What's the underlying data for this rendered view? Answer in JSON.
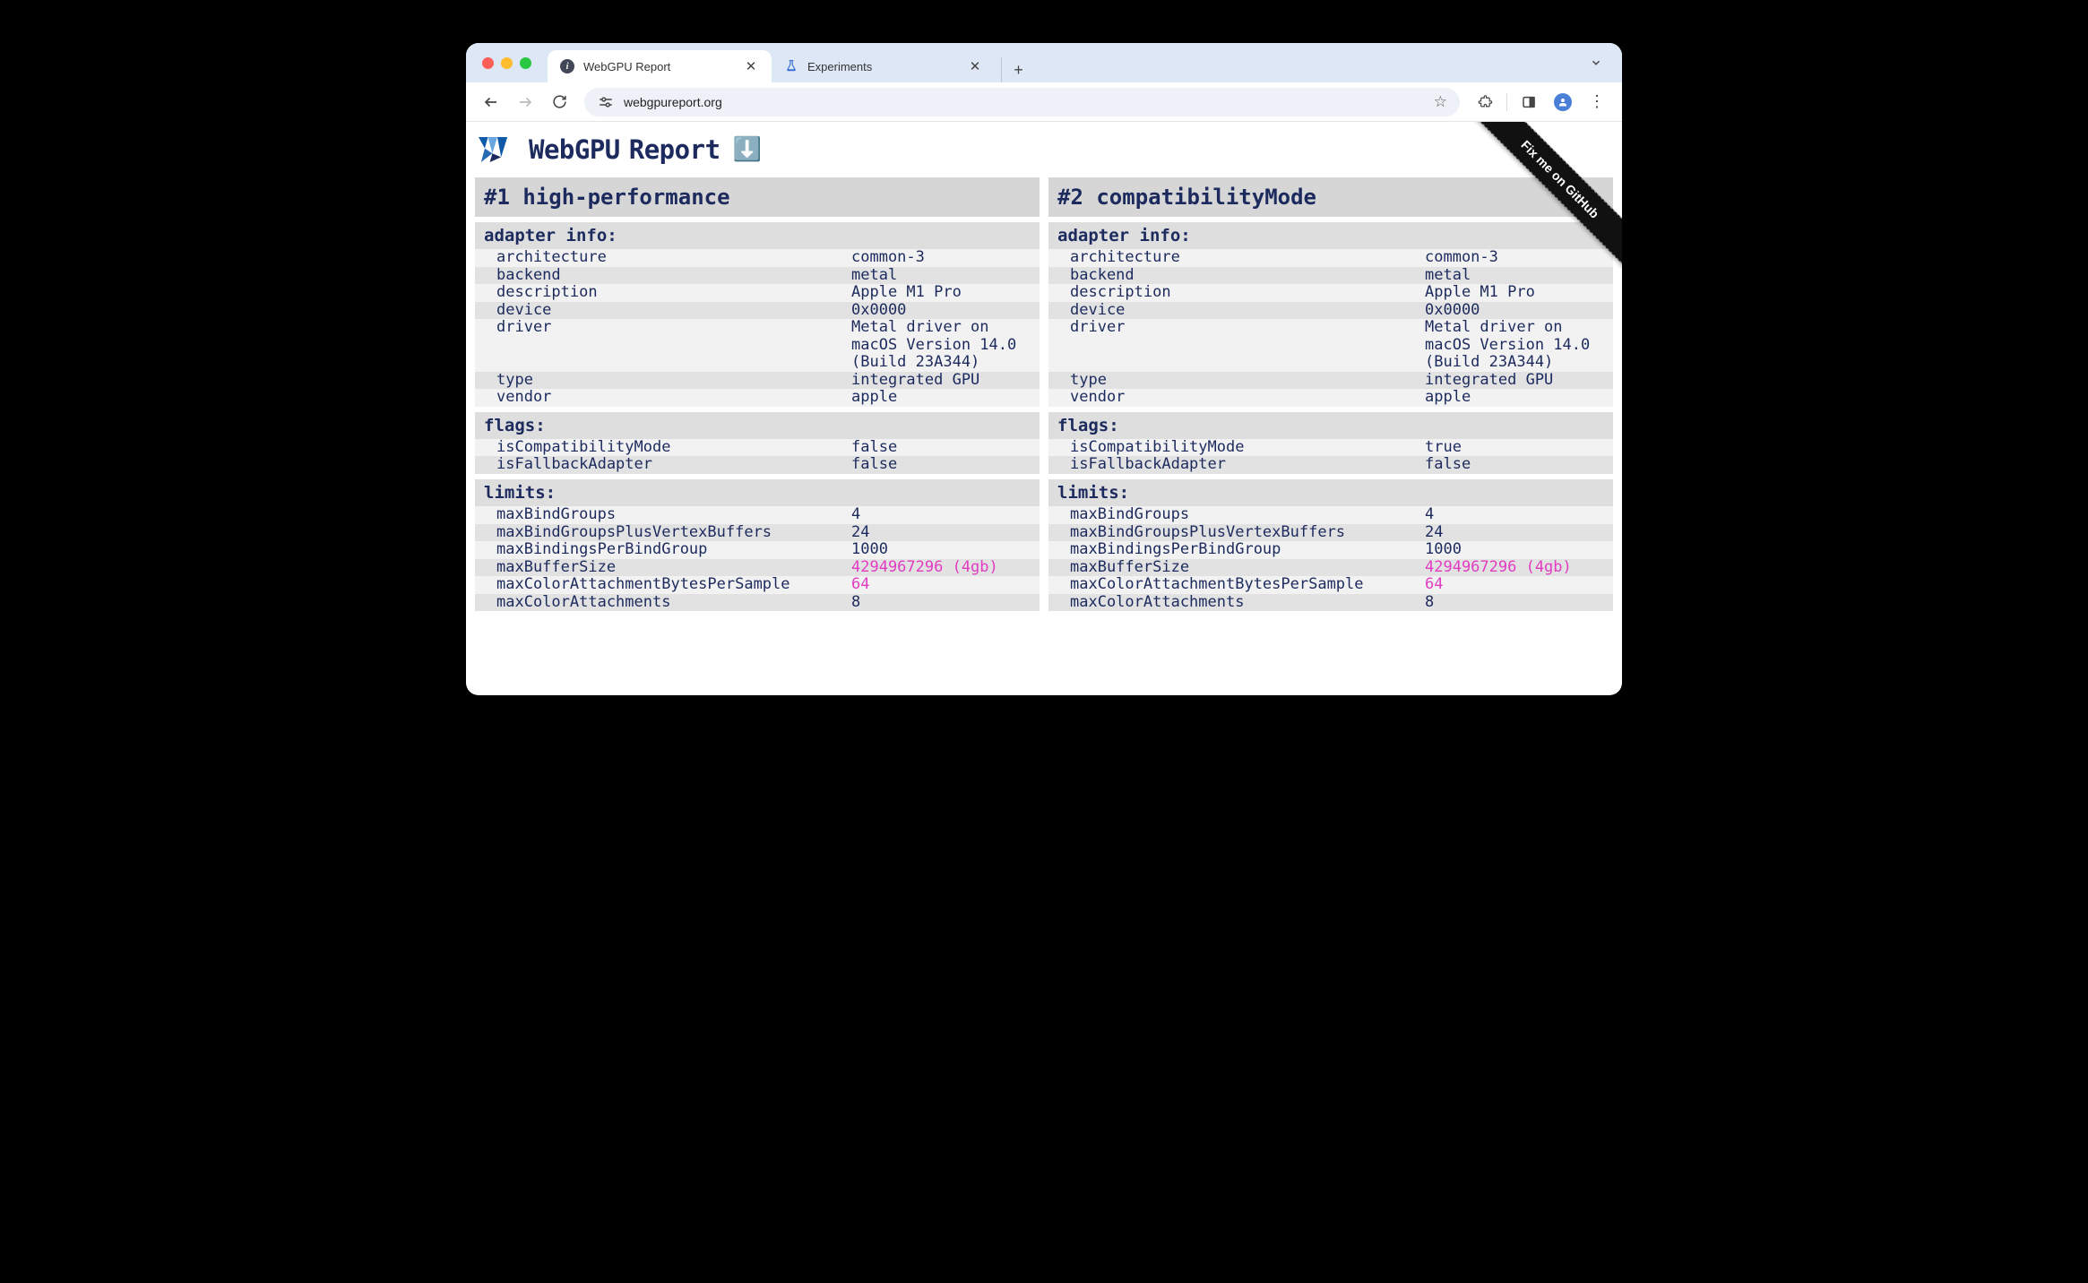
{
  "browser": {
    "tabs": [
      {
        "title": "WebGPU Report",
        "active": true
      },
      {
        "title": "Experiments",
        "active": false
      }
    ],
    "url": "webgpureport.org"
  },
  "page": {
    "title_main": "WebGPU",
    "title_sub": "Report",
    "download_icon": "⬇️",
    "ribbon": "Fix me on GitHub"
  },
  "adapters": [
    {
      "header": "#1 high-performance",
      "sections": [
        {
          "title": "adapter info:",
          "rows": [
            {
              "k": "architecture",
              "v": "common-3"
            },
            {
              "k": "backend",
              "v": "metal"
            },
            {
              "k": "description",
              "v": "Apple M1 Pro"
            },
            {
              "k": "device",
              "v": "0x0000"
            },
            {
              "k": "driver",
              "v": "Metal driver on macOS Version 14.0 (Build 23A344)"
            },
            {
              "k": "type",
              "v": "integrated GPU"
            },
            {
              "k": "vendor",
              "v": "apple"
            }
          ]
        },
        {
          "title": "flags:",
          "rows": [
            {
              "k": "isCompatibilityMode",
              "v": "false"
            },
            {
              "k": "isFallbackAdapter",
              "v": "false"
            }
          ]
        },
        {
          "title": "limits:",
          "rows": [
            {
              "k": "maxBindGroups",
              "v": "4"
            },
            {
              "k": "maxBindGroupsPlusVertexBuffers",
              "v": "24"
            },
            {
              "k": "maxBindingsPerBindGroup",
              "v": "1000"
            },
            {
              "k": "maxBufferSize",
              "v": "4294967296 (4gb)",
              "hl": true
            },
            {
              "k": "maxColorAttachmentBytesPerSample",
              "v": "64",
              "hl": true
            },
            {
              "k": "maxColorAttachments",
              "v": "8"
            }
          ]
        }
      ]
    },
    {
      "header": "#2 compatibilityMode",
      "sections": [
        {
          "title": "adapter info:",
          "rows": [
            {
              "k": "architecture",
              "v": "common-3"
            },
            {
              "k": "backend",
              "v": "metal"
            },
            {
              "k": "description",
              "v": "Apple M1 Pro"
            },
            {
              "k": "device",
              "v": "0x0000"
            },
            {
              "k": "driver",
              "v": "Metal driver on macOS Version 14.0 (Build 23A344)"
            },
            {
              "k": "type",
              "v": "integrated GPU"
            },
            {
              "k": "vendor",
              "v": "apple"
            }
          ]
        },
        {
          "title": "flags:",
          "rows": [
            {
              "k": "isCompatibilityMode",
              "v": "true"
            },
            {
              "k": "isFallbackAdapter",
              "v": "false"
            }
          ]
        },
        {
          "title": "limits:",
          "rows": [
            {
              "k": "maxBindGroups",
              "v": "4"
            },
            {
              "k": "maxBindGroupsPlusVertexBuffers",
              "v": "24"
            },
            {
              "k": "maxBindingsPerBindGroup",
              "v": "1000"
            },
            {
              "k": "maxBufferSize",
              "v": "4294967296 (4gb)",
              "hl": true
            },
            {
              "k": "maxColorAttachmentBytesPerSample",
              "v": "64",
              "hl": true
            },
            {
              "k": "maxColorAttachments",
              "v": "8"
            }
          ]
        }
      ]
    }
  ]
}
